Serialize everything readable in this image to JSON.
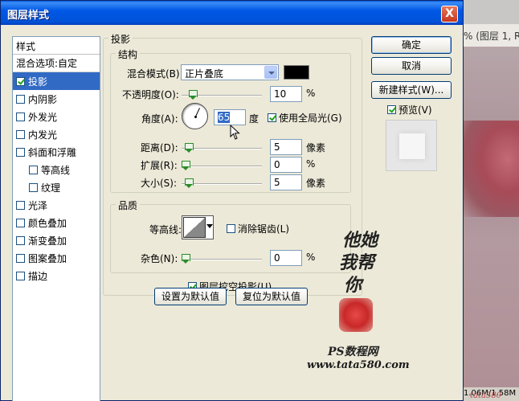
{
  "window": {
    "title": "图层样式",
    "close_label": "X"
  },
  "background": {
    "top_text": "% (图层 1, R",
    "status_text": "1.06M/1.58M"
  },
  "style_list": {
    "header": "样式",
    "items": [
      {
        "label": "混合选项:自定",
        "checkbox": false,
        "checked": false,
        "selected": false,
        "indent": false
      },
      {
        "label": "投影",
        "checkbox": true,
        "checked": true,
        "selected": true,
        "indent": false
      },
      {
        "label": "内阴影",
        "checkbox": true,
        "checked": false,
        "selected": false,
        "indent": false
      },
      {
        "label": "外发光",
        "checkbox": true,
        "checked": false,
        "selected": false,
        "indent": false
      },
      {
        "label": "内发光",
        "checkbox": true,
        "checked": false,
        "selected": false,
        "indent": false
      },
      {
        "label": "斜面和浮雕",
        "checkbox": true,
        "checked": false,
        "selected": false,
        "indent": false
      },
      {
        "label": "等高线",
        "checkbox": true,
        "checked": false,
        "selected": false,
        "indent": true
      },
      {
        "label": "纹理",
        "checkbox": true,
        "checked": false,
        "selected": false,
        "indent": true
      },
      {
        "label": "光泽",
        "checkbox": true,
        "checked": false,
        "selected": false,
        "indent": false
      },
      {
        "label": "颜色叠加",
        "checkbox": true,
        "checked": false,
        "selected": false,
        "indent": false
      },
      {
        "label": "渐变叠加",
        "checkbox": true,
        "checked": false,
        "selected": false,
        "indent": false
      },
      {
        "label": "图案叠加",
        "checkbox": true,
        "checked": false,
        "selected": false,
        "indent": false
      },
      {
        "label": "描边",
        "checkbox": true,
        "checked": false,
        "selected": false,
        "indent": false
      }
    ]
  },
  "drop_shadow": {
    "group_title": "投影",
    "structure": {
      "title": "结构",
      "blend_mode_label": "混合模式(B):",
      "blend_mode_value": "正片叠底",
      "shadow_color": "#000000",
      "opacity_label": "不透明度(O):",
      "opacity_value": "10",
      "opacity_unit": "%",
      "opacity_fraction": 0.1,
      "angle_label": "角度(A):",
      "angle_value": "65",
      "angle_unit": "度",
      "global_light_label": "使用全局光(G)",
      "global_light_checked": true,
      "distance_label": "距离(D):",
      "distance_value": "5",
      "distance_unit": "像素",
      "spread_label": "扩展(R):",
      "spread_value": "0",
      "spread_unit": "%",
      "size_label": "大小(S):",
      "size_value": "5",
      "size_unit": "像素"
    },
    "quality": {
      "title": "品质",
      "contour_label": "等高线:",
      "anti_alias_label": "消除锯齿(L)",
      "anti_alias_checked": false,
      "noise_label": "杂色(N):",
      "noise_value": "0",
      "noise_unit": "%"
    },
    "knockout_label": "图层挖空投影(U)",
    "knockout_checked": true,
    "make_default_label": "设置为默认值",
    "reset_default_label": "复位为默认值"
  },
  "buttons": {
    "ok_label": "确定",
    "cancel_label": "取消",
    "new_style_label": "新建样式(W)...",
    "preview_label": "预览(V)",
    "preview_checked": true
  },
  "watermark": {
    "line1": "他她",
    "line2": "我帮",
    "line3": "你",
    "site_name": "PS数程网",
    "site_url": "www.tata580.com",
    "bottom_text": "tata580"
  }
}
